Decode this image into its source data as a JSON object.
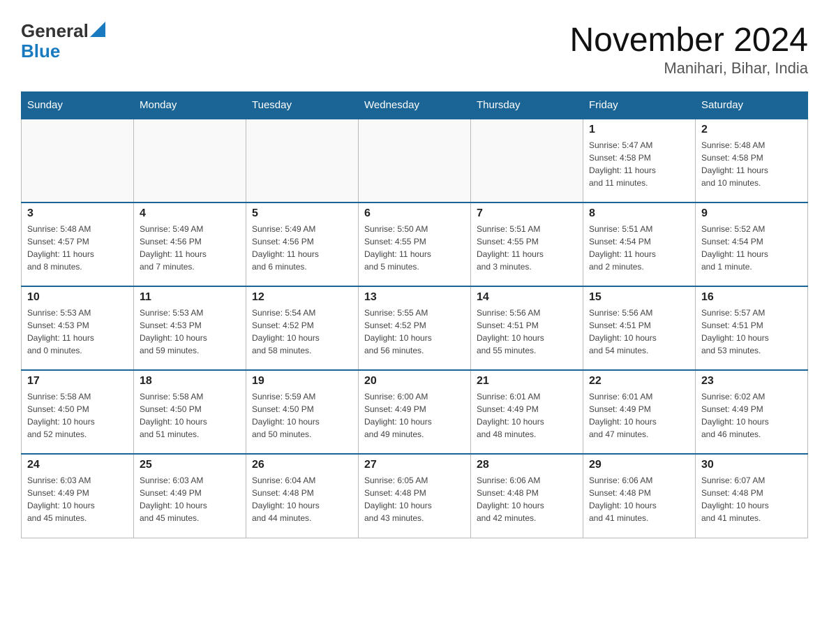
{
  "header": {
    "logo_general": "General",
    "logo_blue": "Blue",
    "title": "November 2024",
    "subtitle": "Manihari, Bihar, India"
  },
  "days_of_week": [
    "Sunday",
    "Monday",
    "Tuesday",
    "Wednesday",
    "Thursday",
    "Friday",
    "Saturday"
  ],
  "weeks": [
    {
      "days": [
        {
          "date": "",
          "info": ""
        },
        {
          "date": "",
          "info": ""
        },
        {
          "date": "",
          "info": ""
        },
        {
          "date": "",
          "info": ""
        },
        {
          "date": "",
          "info": ""
        },
        {
          "date": "1",
          "info": "Sunrise: 5:47 AM\nSunset: 4:58 PM\nDaylight: 11 hours\nand 11 minutes."
        },
        {
          "date": "2",
          "info": "Sunrise: 5:48 AM\nSunset: 4:58 PM\nDaylight: 11 hours\nand 10 minutes."
        }
      ]
    },
    {
      "days": [
        {
          "date": "3",
          "info": "Sunrise: 5:48 AM\nSunset: 4:57 PM\nDaylight: 11 hours\nand 8 minutes."
        },
        {
          "date": "4",
          "info": "Sunrise: 5:49 AM\nSunset: 4:56 PM\nDaylight: 11 hours\nand 7 minutes."
        },
        {
          "date": "5",
          "info": "Sunrise: 5:49 AM\nSunset: 4:56 PM\nDaylight: 11 hours\nand 6 minutes."
        },
        {
          "date": "6",
          "info": "Sunrise: 5:50 AM\nSunset: 4:55 PM\nDaylight: 11 hours\nand 5 minutes."
        },
        {
          "date": "7",
          "info": "Sunrise: 5:51 AM\nSunset: 4:55 PM\nDaylight: 11 hours\nand 3 minutes."
        },
        {
          "date": "8",
          "info": "Sunrise: 5:51 AM\nSunset: 4:54 PM\nDaylight: 11 hours\nand 2 minutes."
        },
        {
          "date": "9",
          "info": "Sunrise: 5:52 AM\nSunset: 4:54 PM\nDaylight: 11 hours\nand 1 minute."
        }
      ]
    },
    {
      "days": [
        {
          "date": "10",
          "info": "Sunrise: 5:53 AM\nSunset: 4:53 PM\nDaylight: 11 hours\nand 0 minutes."
        },
        {
          "date": "11",
          "info": "Sunrise: 5:53 AM\nSunset: 4:53 PM\nDaylight: 10 hours\nand 59 minutes."
        },
        {
          "date": "12",
          "info": "Sunrise: 5:54 AM\nSunset: 4:52 PM\nDaylight: 10 hours\nand 58 minutes."
        },
        {
          "date": "13",
          "info": "Sunrise: 5:55 AM\nSunset: 4:52 PM\nDaylight: 10 hours\nand 56 minutes."
        },
        {
          "date": "14",
          "info": "Sunrise: 5:56 AM\nSunset: 4:51 PM\nDaylight: 10 hours\nand 55 minutes."
        },
        {
          "date": "15",
          "info": "Sunrise: 5:56 AM\nSunset: 4:51 PM\nDaylight: 10 hours\nand 54 minutes."
        },
        {
          "date": "16",
          "info": "Sunrise: 5:57 AM\nSunset: 4:51 PM\nDaylight: 10 hours\nand 53 minutes."
        }
      ]
    },
    {
      "days": [
        {
          "date": "17",
          "info": "Sunrise: 5:58 AM\nSunset: 4:50 PM\nDaylight: 10 hours\nand 52 minutes."
        },
        {
          "date": "18",
          "info": "Sunrise: 5:58 AM\nSunset: 4:50 PM\nDaylight: 10 hours\nand 51 minutes."
        },
        {
          "date": "19",
          "info": "Sunrise: 5:59 AM\nSunset: 4:50 PM\nDaylight: 10 hours\nand 50 minutes."
        },
        {
          "date": "20",
          "info": "Sunrise: 6:00 AM\nSunset: 4:49 PM\nDaylight: 10 hours\nand 49 minutes."
        },
        {
          "date": "21",
          "info": "Sunrise: 6:01 AM\nSunset: 4:49 PM\nDaylight: 10 hours\nand 48 minutes."
        },
        {
          "date": "22",
          "info": "Sunrise: 6:01 AM\nSunset: 4:49 PM\nDaylight: 10 hours\nand 47 minutes."
        },
        {
          "date": "23",
          "info": "Sunrise: 6:02 AM\nSunset: 4:49 PM\nDaylight: 10 hours\nand 46 minutes."
        }
      ]
    },
    {
      "days": [
        {
          "date": "24",
          "info": "Sunrise: 6:03 AM\nSunset: 4:49 PM\nDaylight: 10 hours\nand 45 minutes."
        },
        {
          "date": "25",
          "info": "Sunrise: 6:03 AM\nSunset: 4:49 PM\nDaylight: 10 hours\nand 45 minutes."
        },
        {
          "date": "26",
          "info": "Sunrise: 6:04 AM\nSunset: 4:48 PM\nDaylight: 10 hours\nand 44 minutes."
        },
        {
          "date": "27",
          "info": "Sunrise: 6:05 AM\nSunset: 4:48 PM\nDaylight: 10 hours\nand 43 minutes."
        },
        {
          "date": "28",
          "info": "Sunrise: 6:06 AM\nSunset: 4:48 PM\nDaylight: 10 hours\nand 42 minutes."
        },
        {
          "date": "29",
          "info": "Sunrise: 6:06 AM\nSunset: 4:48 PM\nDaylight: 10 hours\nand 41 minutes."
        },
        {
          "date": "30",
          "info": "Sunrise: 6:07 AM\nSunset: 4:48 PM\nDaylight: 10 hours\nand 41 minutes."
        }
      ]
    }
  ]
}
